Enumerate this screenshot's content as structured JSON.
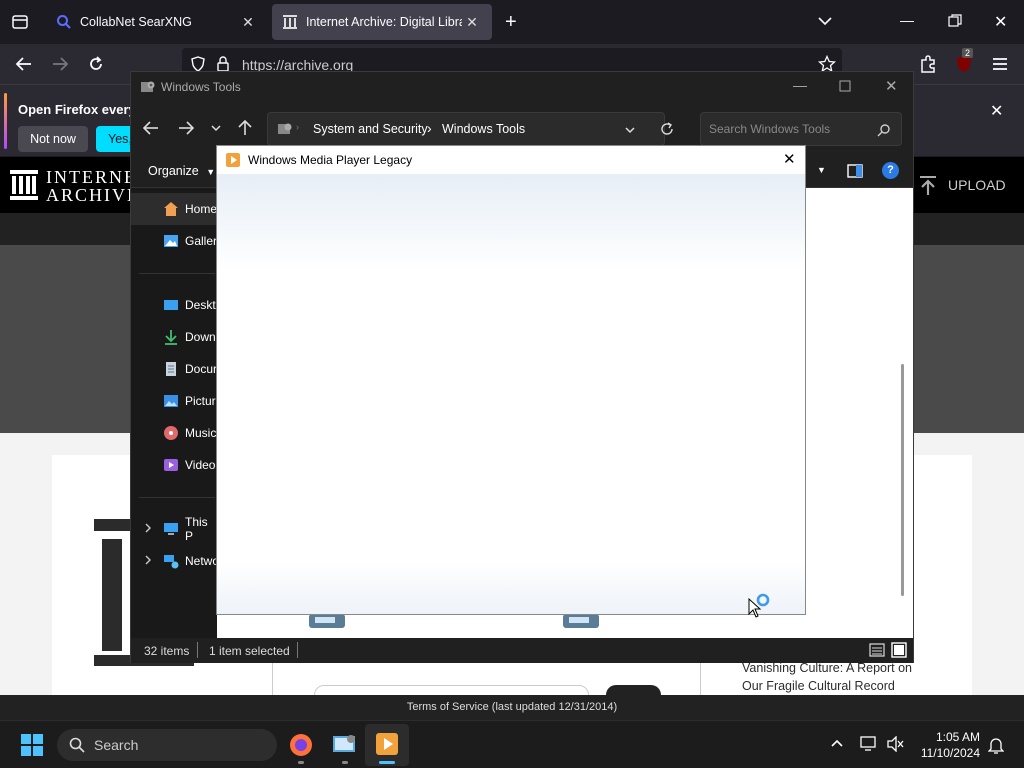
{
  "firefox": {
    "tabs": [
      {
        "title": "CollabNet SearXNG"
      },
      {
        "title": "Internet Archive: Digital Library"
      }
    ],
    "url": "https://archive.org",
    "extension_badge": "2",
    "notification": {
      "text": "Open Firefox every",
      "not_now": "Not now",
      "yes": "Yes,"
    }
  },
  "archive": {
    "logo_line1": "INTERNE",
    "logo_line2": "ARCHIVE",
    "upload_label": "UPLOAD",
    "footer": "Terms of Service (last updated 12/31/2014)",
    "side_article": [
      "Vanishing Culture: A Report on",
      "Our Fragile Cultural Record"
    ]
  },
  "explorer": {
    "window_title": "Windows Tools",
    "breadcrumb": [
      "System and Security",
      "Windows Tools"
    ],
    "search_placeholder": "Search Windows Tools",
    "organize": "Organize",
    "nav": [
      {
        "label": "Home",
        "icon": "home-icon"
      },
      {
        "label": "Galler",
        "icon": "gallery-icon"
      },
      {
        "label": "Deskto",
        "icon": "desktop-icon"
      },
      {
        "label": "Down",
        "icon": "downloads-icon"
      },
      {
        "label": "Docur",
        "icon": "documents-icon"
      },
      {
        "label": "Pictur",
        "icon": "pictures-icon"
      },
      {
        "label": "Music",
        "icon": "music-icon"
      },
      {
        "label": "Video",
        "icon": "videos-icon"
      },
      {
        "label": "This P",
        "icon": "this-pc-icon"
      },
      {
        "label": "Netwo",
        "icon": "network-icon"
      }
    ],
    "status": {
      "items": "32 items",
      "selected": "1 item selected"
    }
  },
  "wmp": {
    "title": "Windows Media Player Legacy"
  },
  "taskbar": {
    "search": "Search",
    "time": "1:05 AM",
    "date": "11/10/2024"
  },
  "colors": {
    "firefox_accent": "#00ddff",
    "archive_black": "#000000",
    "explorer_bg": "#191919",
    "taskbar_bg": "#1c1c1c"
  }
}
